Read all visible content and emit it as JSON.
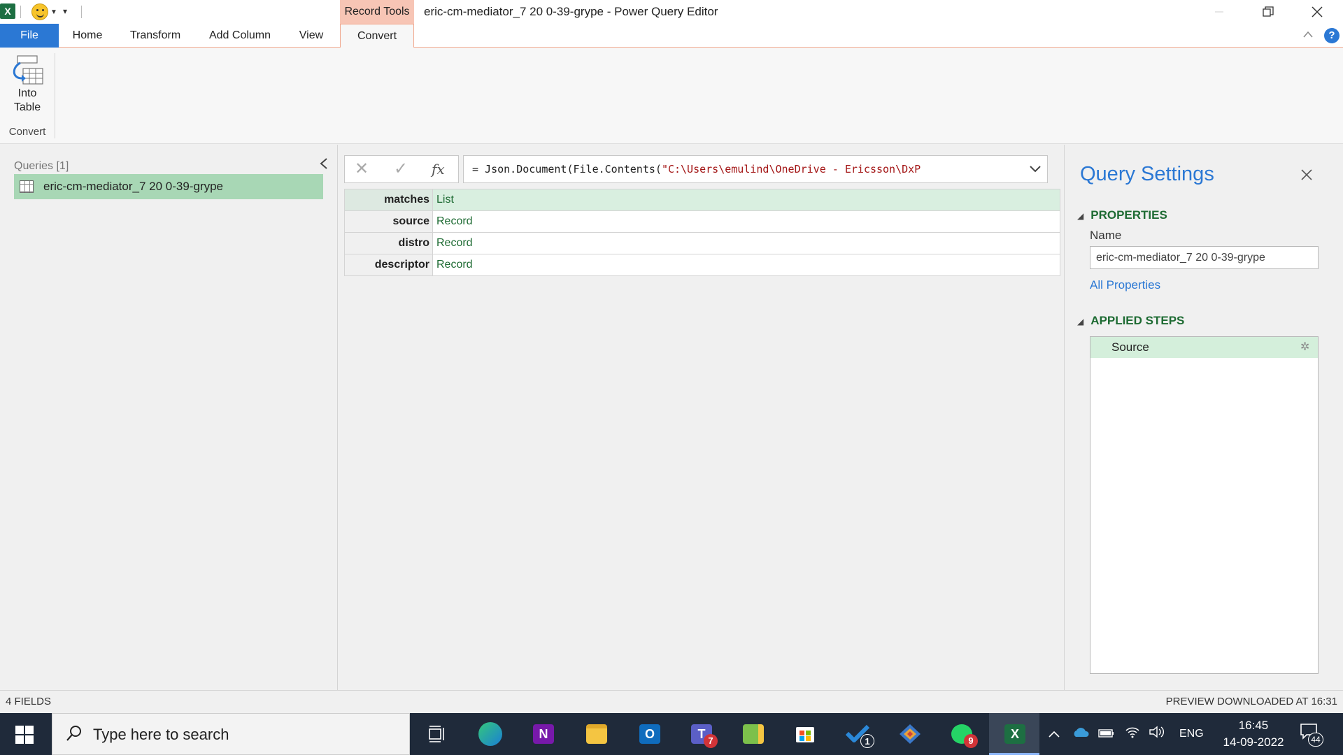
{
  "titlebar": {
    "app_logo": "X",
    "contextual_tab_group": "Record Tools",
    "window_title": "eric-cm-mediator_7 20 0-39-grype - Power Query Editor"
  },
  "ribbon": {
    "tabs": [
      {
        "label": "File"
      },
      {
        "label": "Home"
      },
      {
        "label": "Transform"
      },
      {
        "label": "Add Column"
      },
      {
        "label": "View"
      },
      {
        "label": "Convert"
      }
    ],
    "into_table": {
      "line1": "Into",
      "line2": "Table"
    },
    "group_label": "Convert",
    "help_label": "?"
  },
  "queries": {
    "header": "Queries [1]",
    "items": [
      {
        "name": "eric-cm-mediator_7 20 0-39-grype"
      }
    ]
  },
  "formula": {
    "prefix": "= Json.Document(File.Contents(",
    "string_part": "\"C:\\Users\\emulind\\OneDrive - Ericsson\\DxP",
    "fx_label": "fx"
  },
  "record": {
    "rows": [
      {
        "key": "matches",
        "value": "List"
      },
      {
        "key": "source",
        "value": "Record"
      },
      {
        "key": "distro",
        "value": "Record"
      },
      {
        "key": "descriptor",
        "value": "Record"
      }
    ]
  },
  "settings": {
    "title": "Query Settings",
    "properties_header": "PROPERTIES",
    "name_label": "Name",
    "name_value": "eric-cm-mediator_7 20 0-39-grype",
    "all_properties": "All Properties",
    "applied_steps_header": "APPLIED STEPS",
    "steps": [
      {
        "label": "Source"
      }
    ]
  },
  "status": {
    "left": "4 FIELDS",
    "right": "PREVIEW DOWNLOADED AT 16:31"
  },
  "taskbar": {
    "search_placeholder": "Type here to search",
    "apps": [
      {
        "icon": "task-view-icon"
      },
      {
        "icon": "edge-icon"
      },
      {
        "icon": "onenote-icon",
        "glyph": "N"
      },
      {
        "icon": "file-explorer-icon"
      },
      {
        "icon": "outlook-icon",
        "glyph": "O"
      },
      {
        "icon": "teams-icon",
        "glyph": "T",
        "badge": "7"
      },
      {
        "icon": "sticky-app-icon"
      },
      {
        "icon": "store-icon"
      },
      {
        "icon": "todo-icon",
        "badge": "1"
      },
      {
        "icon": "git-app-icon"
      },
      {
        "icon": "whatsapp-icon",
        "badge": "9"
      },
      {
        "icon": "excel-icon",
        "glyph": "X"
      }
    ],
    "language": "ENG",
    "time": "16:45",
    "date": "14-09-2022",
    "notifications": "44"
  },
  "colors": {
    "accent": "#2b78d4",
    "contextual": "#f7c5b5",
    "selection": "#a8d7b5",
    "section_header": "#1e6b33"
  }
}
